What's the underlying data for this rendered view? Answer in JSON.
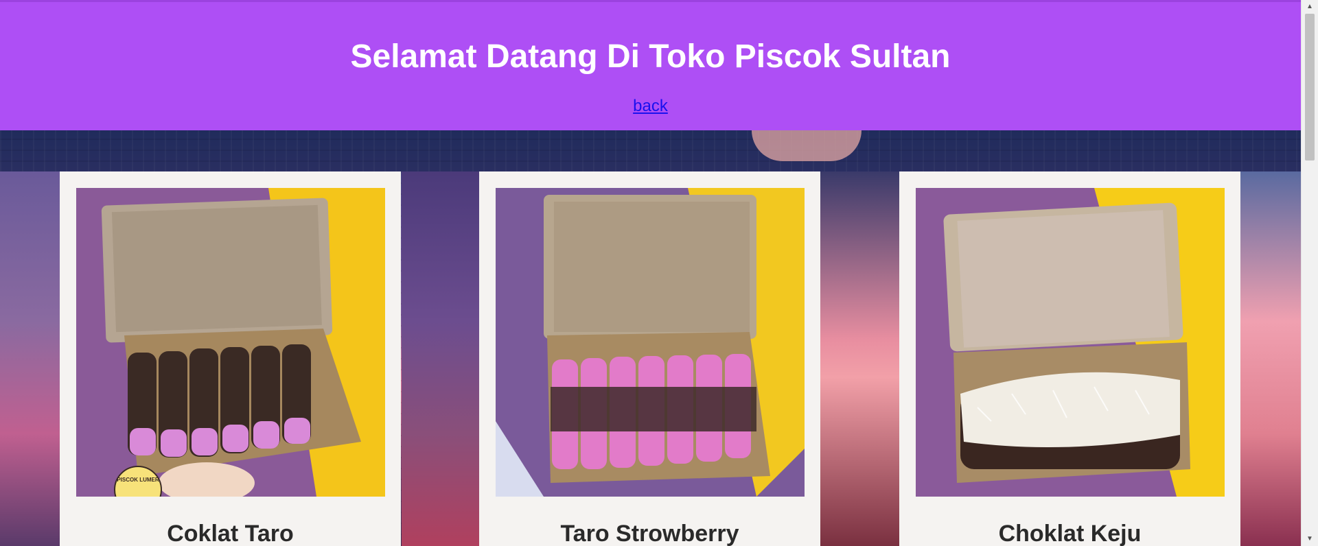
{
  "header": {
    "title": "Selamat Datang Di Toko Piscok Sultan",
    "back_link": "back"
  },
  "products": [
    {
      "name": "Coklat Taro",
      "topping": "chocolate-taro",
      "logo_text": "PISCOK LUMER"
    },
    {
      "name": "Taro Strowberry",
      "topping": "taro-strawberry"
    },
    {
      "name": "Choklat Keju",
      "topping": "chocolate-cheese"
    }
  ],
  "colors": {
    "header_bg": "#ae4ff5",
    "link": "#1a10ee",
    "card_bg": "#f5f3f1"
  },
  "icons": {
    "scroll_up": "chevron-up-icon",
    "scroll_down": "chevron-down-icon"
  }
}
